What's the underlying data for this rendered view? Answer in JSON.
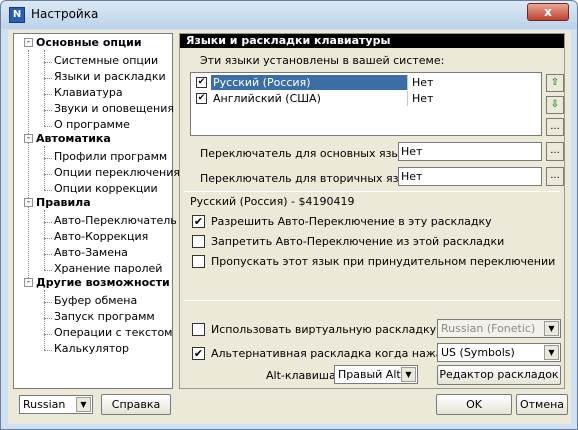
{
  "window": {
    "title": "Настройка",
    "icon": "N",
    "close_glyph": "x"
  },
  "tree": {
    "categories": [
      {
        "label": "Основные опции",
        "expand": "-",
        "items": [
          "Системные опции",
          "Языки и раскладки",
          "Клавиатура",
          "Звуки и оповещения",
          "О программе"
        ]
      },
      {
        "label": "Автоматика",
        "expand": "-",
        "items": [
          "Профили программ",
          "Опции переключения",
          "Опции коррекции"
        ]
      },
      {
        "label": "Правила",
        "expand": "-",
        "items": [
          "Авто-Переключатель",
          "Авто-Коррекция",
          "Авто-Замена",
          "Хранение паролей"
        ]
      },
      {
        "label": "Другие возможности",
        "expand": "-",
        "items": [
          "Буфер обмена",
          "Запуск программ",
          "Операции с текстом",
          "Калькулятор"
        ]
      }
    ]
  },
  "panel": {
    "header": "Языки и раскладки клавиатуры",
    "installed_label": "Эти языки установлены в вашей системе:",
    "languages": [
      {
        "name": "Русский (Россия)",
        "value": "Нет",
        "checked": "✔",
        "selected": true
      },
      {
        "name": "Английский (США)",
        "value": "Нет",
        "checked": "✔",
        "selected": false
      }
    ],
    "move_up_glyph": "⇧",
    "move_down_glyph": "⇩",
    "dots": "...",
    "primary_switcher_label": "Переключатель для основных языков:",
    "primary_switcher_value": "Нет",
    "secondary_switcher_label": "Переключатель для вторичных языков:",
    "secondary_switcher_value": "Нет",
    "layout_title": "Русский (Россия) - $4190419",
    "options": [
      {
        "label": "Разрешить Авто-Переключение в эту раскладку",
        "checked": "✔"
      },
      {
        "label": "Запретить Авто-Переключение из этой раскладки",
        "checked": ""
      },
      {
        "label": "Пропускать этот язык при принудительном переключении",
        "checked": ""
      }
    ],
    "virtual_layout_label": "Использовать виртуальную раскладку",
    "virtual_layout_checked": "",
    "virtual_layout_value": "Russian (Fonetic)",
    "alt_layout_label": "Альтернативная раскладка когда нажат Alt",
    "alt_layout_checked": "✔",
    "alt_layout_value": "US (Symbols)",
    "alt_key_label": "Alt-клавиша:",
    "alt_key_value": "Правый Alt",
    "layout_editor_label": "Редактор раскладок"
  },
  "bottom": {
    "language_select": "Russian",
    "help_label": "Справка",
    "ok_label": "OK",
    "cancel_label": "Отмена"
  },
  "dropdown_glyph": "▼"
}
